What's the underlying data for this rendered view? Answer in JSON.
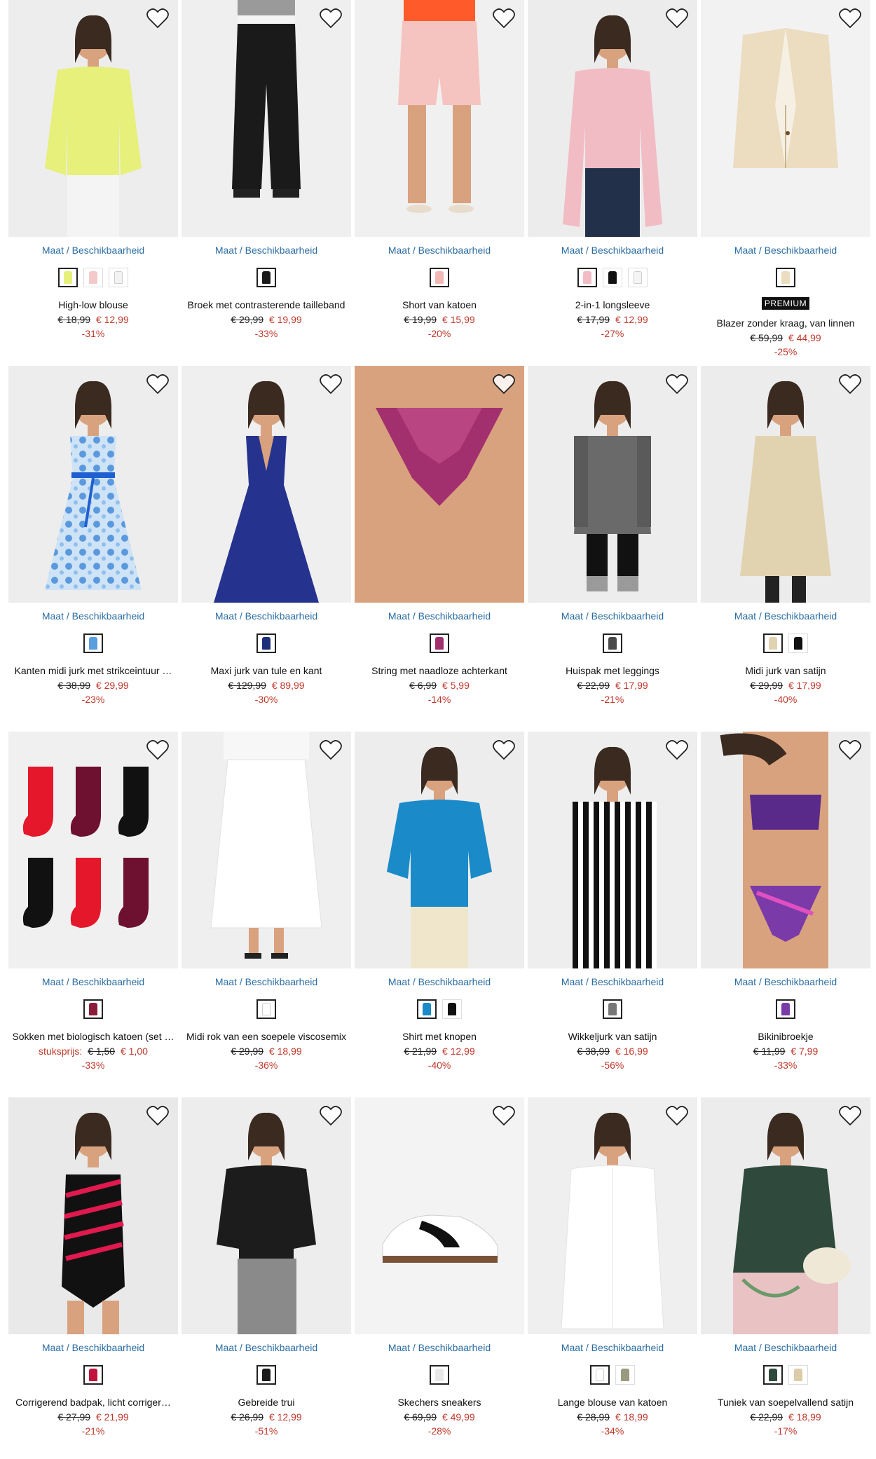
{
  "availability_label": "Maat / Beschikbaarheid",
  "colors": {
    "price_red": "#c0392b",
    "link_blue": "#2b6da3"
  },
  "rows": [
    {
      "products": [
        {
          "name": "High-low blouse",
          "old_price": "€ 18,99",
          "new_price": "€ 12,99",
          "discount": "-31%",
          "bg": "#ededed",
          "model": "blouse",
          "swatches": [
            "#e6f07a",
            "#f4c9c9",
            "#f2f2f2"
          ],
          "selected": 0
        },
        {
          "name": "Broek met contrasterende tailleband",
          "old_price": "€ 29,99",
          "new_price": "€ 19,99",
          "discount": "-33%",
          "bg": "#efefef",
          "model": "trousers",
          "swatches": [
            "#1a1a1a"
          ],
          "selected": 0
        },
        {
          "name": "Short van katoen",
          "old_price": "€ 19,99",
          "new_price": "€ 15,99",
          "discount": "-20%",
          "bg": "#f0f0f0",
          "model": "shorts",
          "swatches": [
            "#f3b8b4"
          ],
          "selected": 0
        },
        {
          "name": "2-in-1 longsleeve",
          "old_price": "€ 17,99",
          "new_price": "€ 12,99",
          "discount": "-27%",
          "bg": "#ececec",
          "model": "pinktop",
          "swatches": [
            "#f2bcc4",
            "#111111",
            "#f4f4f4"
          ],
          "selected": 0
        },
        {
          "name": "Blazer zonder kraag, van linnen",
          "old_price": "€ 59,99",
          "new_price": "€ 44,99",
          "discount": "-25%",
          "bg": "#f2f2f2",
          "model": "blazer",
          "swatches": [
            "#ecdcc0"
          ],
          "selected": 0,
          "badge": "PREMIUM"
        }
      ]
    },
    {
      "products": [
        {
          "name": "Kanten midi jurk met strikceintuur …",
          "old_price": "€ 38,99",
          "new_price": "€ 29,99",
          "discount": "-23%",
          "bg": "#ededed",
          "model": "bluedress",
          "swatches": [
            "#5aa0e0"
          ],
          "selected": 0
        },
        {
          "name": "Maxi jurk van tule en kant",
          "old_price": "€ 129,99",
          "new_price": "€ 89,99",
          "discount": "-30%",
          "bg": "#efefef",
          "model": "navygown",
          "swatches": [
            "#1f2f7a"
          ],
          "selected": 0
        },
        {
          "name": "String met naadloze achterkant",
          "old_price": "€ 6,99",
          "new_price": "€ 5,99",
          "discount": "-14%",
          "bg": "#e8e4e4",
          "model": "string",
          "swatches": [
            "#a3306e"
          ],
          "selected": 0
        },
        {
          "name": "Huispak met leggings",
          "old_price": "€ 22,99",
          "new_price": "€ 17,99",
          "discount": "-21%",
          "bg": "#ededed",
          "model": "homesuit",
          "swatches": [
            "#4a4a4a"
          ],
          "selected": 0
        },
        {
          "name": "Midi jurk van satijn",
          "old_price": "€ 29,99",
          "new_price": "€ 17,99",
          "discount": "-40%",
          "bg": "#ececec",
          "model": "satindress",
          "swatches": [
            "#e2d3b0",
            "#111111"
          ],
          "selected": 0
        }
      ]
    },
    {
      "products": [
        {
          "name": "Sokken met biologisch katoen (set …",
          "old_price": "€ 1,50",
          "new_price": "€ 1,00",
          "discount": "-33%",
          "bg": "#f0f0f0",
          "model": "socks",
          "swatches": [
            "#8b1d3a"
          ],
          "selected": 0,
          "price_label": "stuksprijs:"
        },
        {
          "name": "Midi rok van een soepele viscosemix",
          "old_price": "€ 29,99",
          "new_price": "€ 18,99",
          "discount": "-36%",
          "bg": "#efefef",
          "model": "whiteskirt",
          "swatches": [
            "#ffffff"
          ],
          "selected": 0
        },
        {
          "name": "Shirt met knopen",
          "old_price": "€ 21,99",
          "new_price": "€ 12,99",
          "discount": "-40%",
          "bg": "#ededed",
          "model": "blueshirt",
          "swatches": [
            "#1a8ac8",
            "#111111"
          ],
          "selected": 0
        },
        {
          "name": "Wikkeljurk van satijn",
          "old_price": "€ 38,99",
          "new_price": "€ 16,99",
          "discount": "-56%",
          "bg": "#eeeeee",
          "model": "stripedress",
          "swatches": [
            "#777777"
          ],
          "selected": 0
        },
        {
          "name": "Bikinibroekje",
          "old_price": "€ 11,99",
          "new_price": "€ 7,99",
          "discount": "-33%",
          "bg": "#ececec",
          "model": "bikini",
          "swatches": [
            "#7a3aa8"
          ],
          "selected": 0
        }
      ]
    },
    {
      "products": [
        {
          "name": "Corrigerend badpak, licht corriger…",
          "old_price": "€ 27,99",
          "new_price": "€ 21,99",
          "discount": "-21%",
          "bg": "#e9e9e9",
          "model": "swimsuit",
          "swatches": [
            "#c0143c"
          ],
          "selected": 0
        },
        {
          "name": "Gebreide trui",
          "old_price": "€ 26,99",
          "new_price": "€ 12,99",
          "discount": "-51%",
          "bg": "#ededed",
          "model": "knit",
          "swatches": [
            "#1a1a1a"
          ],
          "selected": 0
        },
        {
          "name": "Skechers sneakers",
          "old_price": "€ 69,99",
          "new_price": "€ 49,99",
          "discount": "-28%",
          "bg": "#f3f3f3",
          "model": "sneaker",
          "swatches": [
            "#e8e8e8"
          ],
          "selected": 0
        },
        {
          "name": "Lange blouse van katoen",
          "old_price": "€ 28,99",
          "new_price": "€ 18,99",
          "discount": "-34%",
          "bg": "#efefef",
          "model": "whiteblouse",
          "swatches": [
            "#ffffff",
            "#9a9a80"
          ],
          "selected": 0
        },
        {
          "name": "Tuniek van soepelvallend satijn",
          "old_price": "€ 22,99",
          "new_price": "€ 18,99",
          "discount": "-17%",
          "bg": "#ececec",
          "model": "greentunic",
          "swatches": [
            "#2f4a3c",
            "#dccca8"
          ],
          "selected": 0
        }
      ]
    }
  ]
}
